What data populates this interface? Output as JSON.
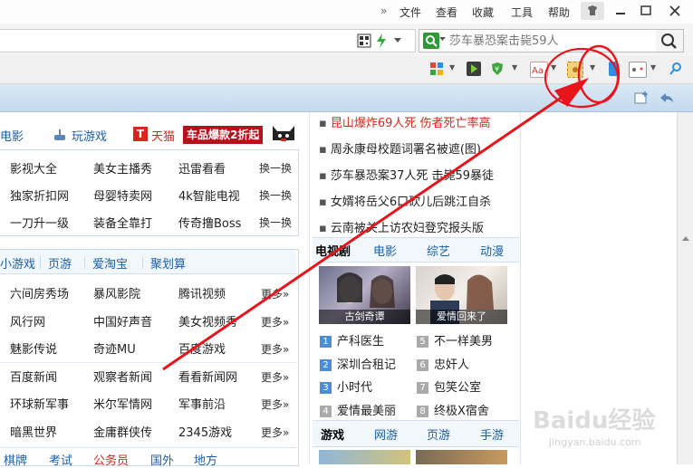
{
  "titlebar": {
    "chevron": "»",
    "menu": [
      "文件",
      "查看",
      "收藏",
      "工具",
      "帮助"
    ]
  },
  "search": {
    "placeholder": "莎车暴恐案击毙59人"
  },
  "colors": {
    "accent_blue": "#1a5ea8",
    "red": "#d9261c",
    "annotation": "#e8141b",
    "news_red": "#d9261c"
  },
  "topnav": {
    "movie": "电影",
    "games": "玩游戏",
    "tmall": "天猫",
    "promo": "车品爆款2折起"
  },
  "panel1": {
    "rows": [
      {
        "cells": [
          "影视大全",
          "美女主播秀",
          "迅雷看看"
        ],
        "more": "换一换"
      },
      {
        "cells": [
          "独家折扣网",
          "母婴特卖网",
          "4k智能电视"
        ],
        "more": "换一换"
      },
      {
        "cells": [
          "一刀升一级",
          "装备全靠打",
          "传奇撸Boss"
        ],
        "more": "换一换"
      }
    ]
  },
  "panel2": {
    "tabs": [
      "小游戏",
      "页游",
      "爱淘宝",
      "聚划算"
    ],
    "rows": [
      {
        "cells": [
          "六间房秀场",
          "暴风影院",
          "腾讯视频"
        ],
        "more": "更多»"
      },
      {
        "cells": [
          "风行网",
          "中国好声音",
          "美女视频秀"
        ],
        "more": "更多»"
      },
      {
        "cells": [
          "魅影传说",
          "奇迹MU",
          "百度游戏"
        ],
        "more": "更多»"
      },
      {
        "cells": [
          "百度新闻",
          "观察者新闻",
          "看看新闻网"
        ],
        "more": "更多»"
      },
      {
        "cells": [
          "环球新军事",
          "米尔军情网",
          "军事前沿"
        ],
        "more": "更多»"
      },
      {
        "cells": [
          "暗黑世界",
          "金庸群侠传",
          "2345游戏"
        ],
        "more": "更多»"
      }
    ],
    "bottom_tabs": [
      "棋牌",
      "考试",
      "公务员",
      "国外",
      "地方"
    ]
  },
  "news": [
    {
      "text": "昆山爆炸69人死 伤者死亡率高",
      "hot": true
    },
    {
      "text": "周永康母校题词署名被遮(图)",
      "hot": false
    },
    {
      "text": "莎车暴恐案37人死 击毙59暴徒",
      "hot": false
    },
    {
      "text": "女婿将岳父6口砍儿后跳江自杀",
      "hot": false
    },
    {
      "text": "云南被关上访农妇登究报头版",
      "hot": false
    }
  ],
  "video": {
    "tabs": [
      "电视剧",
      "电影",
      "综艺",
      "动漫"
    ],
    "thumbs": [
      "古剑奇谭",
      "爱情回来了"
    ],
    "list_left": [
      {
        "n": "1",
        "t": "产科医生"
      },
      {
        "n": "2",
        "t": "深圳合租记"
      },
      {
        "n": "3",
        "t": "小时代"
      },
      {
        "n": "4",
        "t": "爱情最美丽"
      }
    ],
    "list_right": [
      {
        "n": "5",
        "t": "不一样美男"
      },
      {
        "n": "6",
        "t": "忠奸人"
      },
      {
        "n": "7",
        "t": "包笑公室"
      },
      {
        "n": "8",
        "t": "终极X宿舍"
      }
    ]
  },
  "game_tabs": [
    "游戏",
    "网游",
    "页游",
    "手游"
  ],
  "watermark": {
    "brand": "Baidu经验",
    "url": "jingyan.baidu.com"
  }
}
